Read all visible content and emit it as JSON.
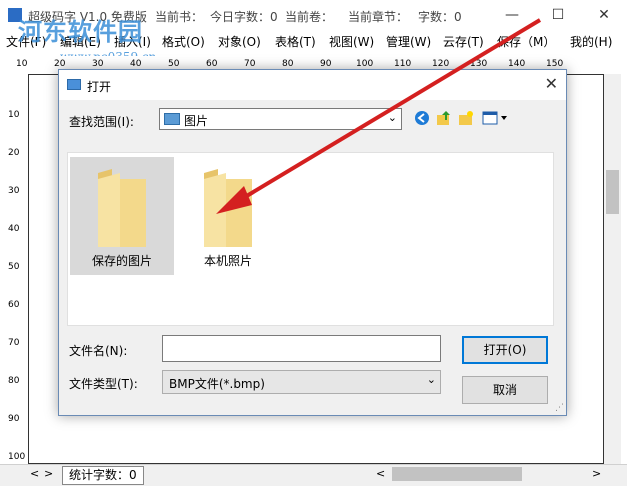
{
  "app": {
    "title": "超级码字 V1.0 免费版",
    "current_book": "当前书：",
    "today_words": "今日字数：0",
    "current_volume": "当前卷：",
    "current_chapter": "当前章节：",
    "word_count": "字数：0"
  },
  "menu": [
    "文件(F)",
    "编辑(E)",
    "插入(I)",
    "格式(O)",
    "对象(O)",
    "表格(T)",
    "视图(W)",
    "管理(W)",
    "云存(T)",
    "保存（M）",
    "我的(H)"
  ],
  "watermark": {
    "text": "河东软件园",
    "url": "www.pc0359.cn"
  },
  "ruler_top": [
    "10",
    "20",
    "30",
    "40",
    "50",
    "60",
    "70",
    "80",
    "90",
    "100",
    "110",
    "120",
    "130",
    "140",
    "150"
  ],
  "ruler_left": [
    "10",
    "20",
    "30",
    "40",
    "50",
    "60",
    "70",
    "80",
    "90",
    "100"
  ],
  "status": {
    "word_count": "统计字数：0"
  },
  "dialog": {
    "title": "打开",
    "look_in_label": "查找范围(I):",
    "look_in_value": "图片",
    "folders": [
      {
        "name": "保存的图片",
        "selected": true
      },
      {
        "name": "本机照片",
        "selected": false
      }
    ],
    "filename_label": "文件名(N):",
    "filename_value": "",
    "filetype_label": "文件类型(T):",
    "filetype_value": "BMP文件(*.bmp)",
    "open_button": "打开(O)",
    "cancel_button": "取消",
    "close_glyph": "✕"
  },
  "colors": {
    "arrow": "#d42020",
    "folder": "#f3d98b",
    "folder_dark": "#e7c46a",
    "selection": "#d9d9d9",
    "accent": "#0078d7"
  }
}
